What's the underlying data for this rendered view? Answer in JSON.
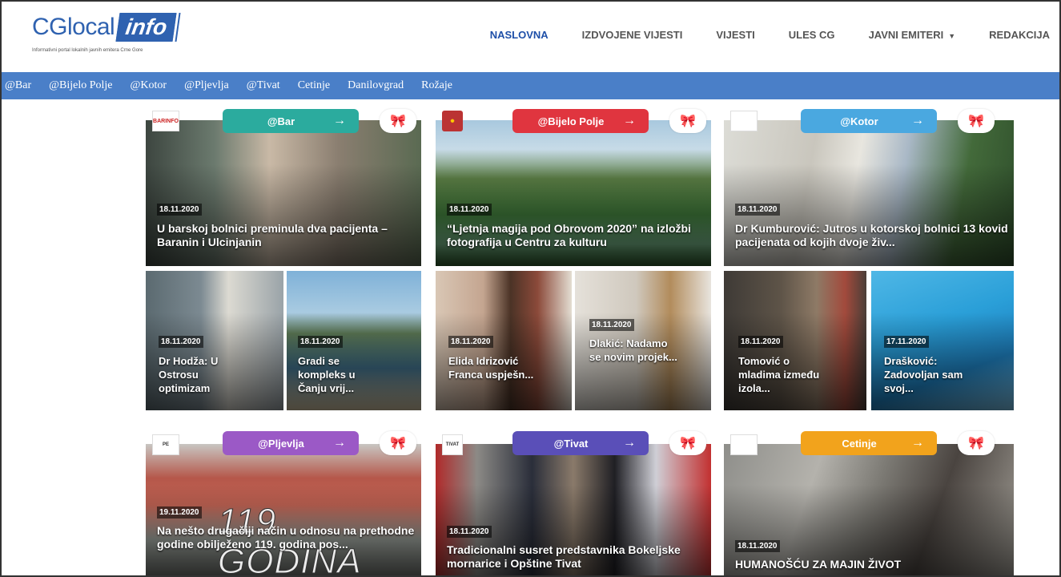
{
  "logo": {
    "name": "CGlocal",
    "box": "info",
    "tagline": "Informativni portal lokalnih javnih emitera Crne Gore"
  },
  "nav": [
    {
      "label": "NASLOVNA"
    },
    {
      "label": "IZDVOJENE VIJESTI"
    },
    {
      "label": "VIJESTI"
    },
    {
      "label": "ULES CG"
    },
    {
      "label": "JAVNI EMITERI"
    },
    {
      "label": "REDAKCIJA"
    }
  ],
  "subnav": [
    "@Bar",
    "@Bijelo Polje",
    "@Kotor",
    "@Pljevlja",
    "@Tivat",
    "Cetinje",
    "Danilovgrad",
    "Rožaje"
  ],
  "sections": [
    {
      "tag": "@Bar",
      "color": "#2bab9e",
      "arrow": "→",
      "logo": "BARINFO",
      "main": {
        "date": "18.11.2020",
        "title": "U barskoj bolnici preminula dva pacijenta – Baranin i Ulcinjanin"
      },
      "subs": [
        {
          "date": "18.11.2020",
          "title": "Dr Hodža: U Ostrosu optimizam"
        },
        {
          "date": "18.11.2020",
          "title": "Gradi se kompleks u Čanju vrij..."
        }
      ]
    },
    {
      "tag": "@Bijelo Polje",
      "color": "#e0353f",
      "arrow": "→",
      "logo": "",
      "main": {
        "date": "18.11.2020",
        "title": "“Ljetnja magija pod Obrovom 2020” na izložbi fotografija u Centru za kulturu"
      },
      "subs": [
        {
          "date": "18.11.2020",
          "title": "Elida Idrizović Franca uspješn..."
        },
        {
          "date": "18.11.2020",
          "title": "Dlakić: Nadamo se novim projek..."
        }
      ]
    },
    {
      "tag": "@Kotor",
      "color": "#4aa8e0",
      "arrow": "→",
      "logo": "",
      "main": {
        "date": "18.11.2020",
        "title": "Dr Kumburović: Jutros u kotorskoj bolnici 13 kovid pacijenata od kojih dvoje živ..."
      },
      "subs": [
        {
          "date": "18.11.2020",
          "title": "Tomović o mladima između izola..."
        },
        {
          "date": "17.11.2020",
          "title": "Drašković: Zadovoljan sam svoj..."
        }
      ]
    },
    {
      "tag": "@Pljevlja",
      "color": "#9b59c6",
      "arrow": "→",
      "logo": "PE",
      "main": {
        "date": "19.11.2020",
        "title": "Na nešto drugačiji način u odnosu na prethodne godine obilježeno 119. godina pos...",
        "overlay": "119 GODINA"
      }
    },
    {
      "tag": "@Tivat",
      "color": "#5a4fb8",
      "arrow": "→",
      "logo": "TIVAT",
      "main": {
        "date": "18.11.2020",
        "title": "Tradicionalni susret predstavnika Bokeljske mornarice i Opštine Tivat"
      }
    },
    {
      "tag": "Cetinje",
      "color": "#f2a31c",
      "arrow": "→",
      "logo": "",
      "main": {
        "date": "18.11.2020",
        "title": "HUMANOŠĆU ZA MAJIN ŽIVOT"
      }
    }
  ]
}
